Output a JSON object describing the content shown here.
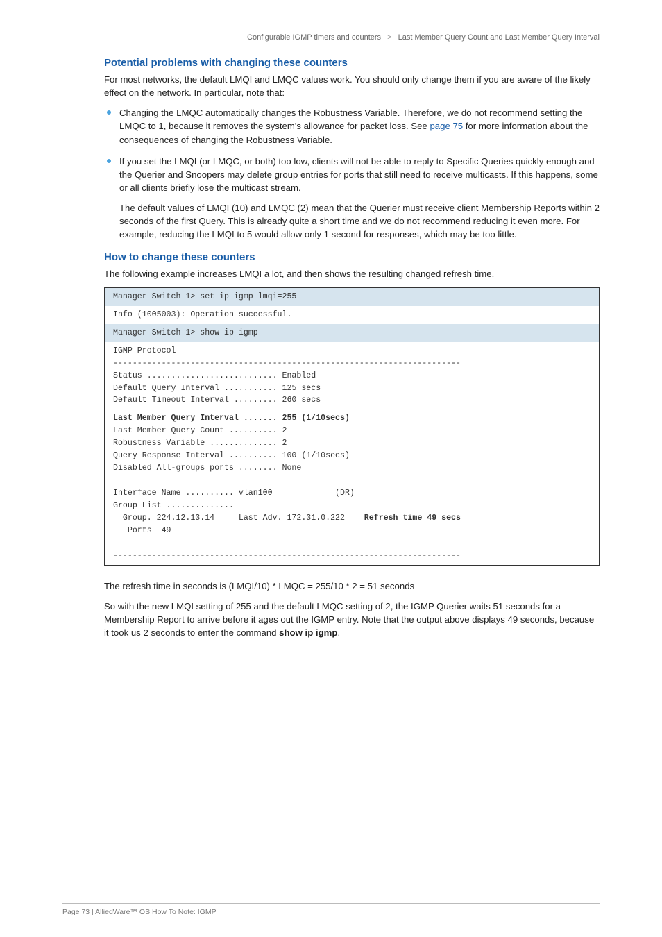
{
  "breadcrumb": {
    "left": "Configurable IGMP timers and counters",
    "right": "Last Member Query Count and Last Member Query Interval"
  },
  "section1": {
    "heading": "Potential problems with changing these counters",
    "intro": "For most networks, the default LMQI and LMQC values work. You should only change them if you are aware of the likely effect on the network. In particular, note that:",
    "bullet1a": "Changing the LMQC automatically changes the Robustness Variable. Therefore, we do not recommend setting the LMQC to 1, because it removes the system's allowance for packet loss. See ",
    "bullet1_link": "page 75",
    "bullet1b": " for more information about the consequences of changing the Robustness Variable.",
    "bullet2": "If you set the LMQI (or LMQC, or both) too low, clients will not be able to reply to Specific Queries quickly enough and the Querier and Snoopers may delete group entries for ports that still need to receive multicasts. If this happens, some or all clients briefly lose the multicast stream.",
    "bullet2p2": "The default values of LMQI (10) and LMQC (2) mean that the Querier must receive client Membership Reports within 2 seconds of the first Query. This is already quite a short time and we do not recommend reducing it even more. For example, reducing the LMQI to 5 would allow only 1 second for responses, which may be too little."
  },
  "section2": {
    "heading": "How to change these counters",
    "intro": "The following example increases LMQI a lot, and then shows the resulting changed refresh time."
  },
  "code": {
    "l1": "Manager Switch 1> set ip igmp lmqi=255",
    "l2": "Info (1005003): Operation successful.",
    "l3": "Manager Switch 1> show ip igmp",
    "block1": "IGMP Protocol\n------------------------------------------------------------------------\nStatus ........................... Enabled\nDefault Query Interval ........... 125 secs\nDefault Timeout Interval ......... 260 secs",
    "block2_bold": "Last Member Query Interval ....... 255 (1/10secs)",
    "block2_rest": "Last Member Query Count .......... 2\nRobustness Variable .............. 2\nQuery Response Interval .......... 100 (1/10secs)\nDisabled All-groups ports ........ None\n\nInterface Name .......... vlan100             (DR)\nGroup List ..............",
    "block3_pre": "  Group. 224.12.13.14     Last Adv. 172.31.0.222    ",
    "block3_bold": "Refresh time 49 secs",
    "block3_post": "   Ports  49\n\n------------------------------------------------------------------------"
  },
  "tail": {
    "p1": "The refresh time in seconds is (LMQI/10) * LMQC = 255/10 * 2 = 51 seconds",
    "p2a": "So with the new LMQI setting of 255 and the default LMQC setting of 2, the IGMP Querier waits 51 seconds for a Membership Report to arrive before it ages out the IGMP entry. Note that the output above displays 49 seconds, because it took us 2 seconds to enter the command ",
    "p2_bold": "show ip igmp",
    "p2b": "."
  },
  "footer": "Page 73 | AlliedWare™ OS How To Note: IGMP"
}
